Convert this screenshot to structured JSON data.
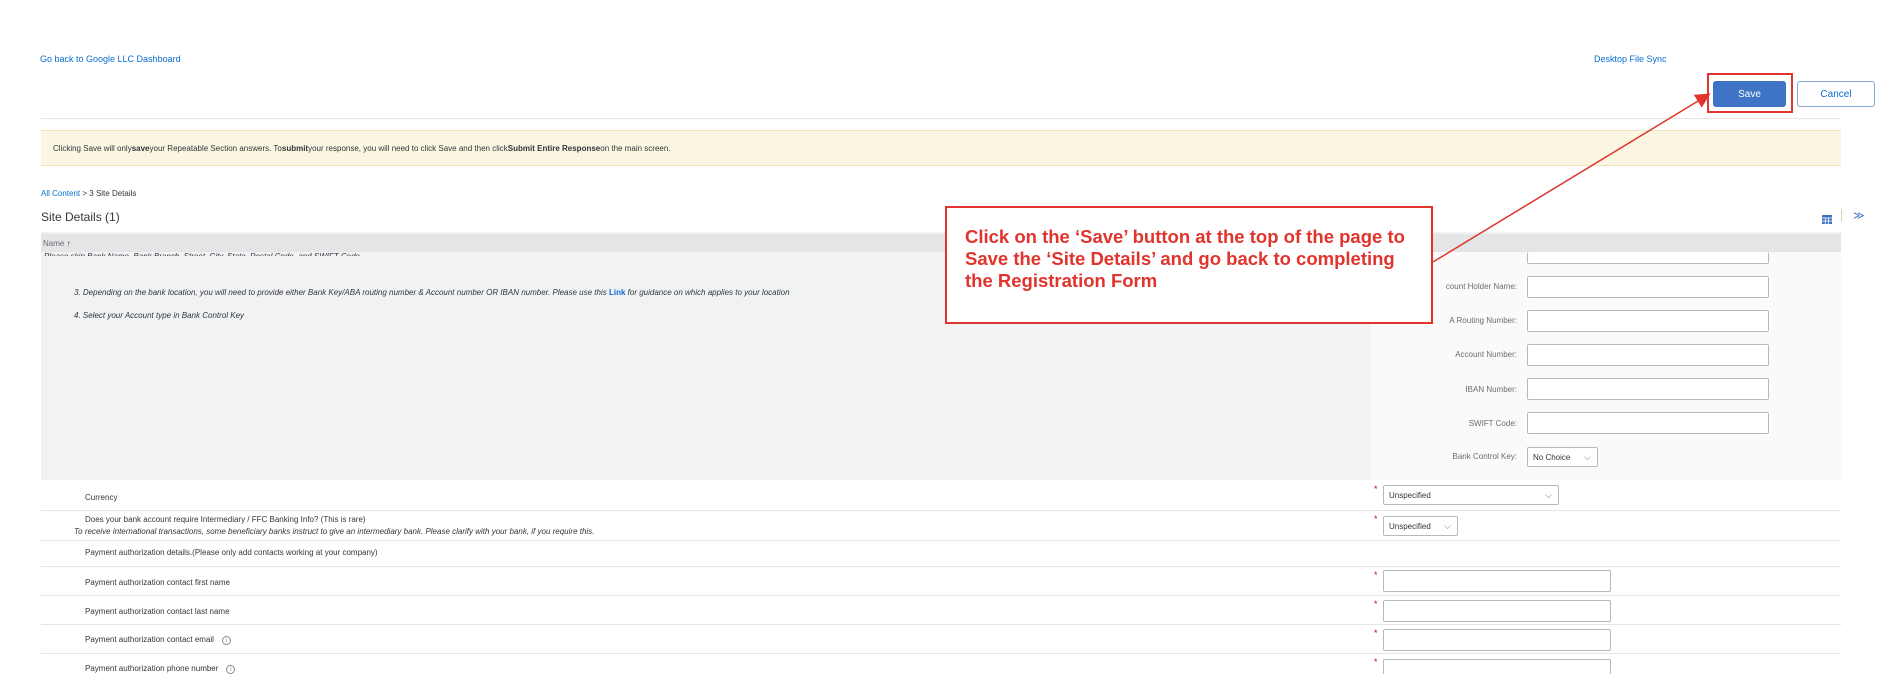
{
  "header": {
    "back_link": "Go back to Google LLC Dashboard",
    "desktop_sync": "Desktop File Sync"
  },
  "toolbar": {
    "save_label": "Save",
    "cancel_label": "Cancel"
  },
  "banner": {
    "p1": "Clicking Save will only ",
    "b1": "save",
    "p2": " your Repeatable Section answers. To ",
    "b2": "submit",
    "p3": " your response, you will need to click Save and then click ",
    "b3": "Submit Entire Response",
    "p4": " on the main screen."
  },
  "breadcrumb": {
    "root": "All Content",
    "sep": " > ",
    "current": "3 Site Details"
  },
  "section": {
    "title": "Site Details (1)",
    "name_col": "Name",
    "name_sort": "↑"
  },
  "instructions": {
    "cut_line": "Please skip Bank Name, Bank Branch, Street, City, State, Postal Code, and SWIFT Code.",
    "line3_pre": "3. Depending on the bank location, you will need to provide either Bank Key/ABA routing number & Account number OR IBAN number. Please use this ",
    "line3_link": "Link",
    "line3_post": " for guidance on which applies to your location",
    "line4": "4. Select your Account type in Bank Control Key"
  },
  "bank_fields": {
    "account_holder": "count Holder Name:",
    "aba_routing": "A Routing Number:",
    "account_number": "Account Number:",
    "iban": "IBAN Number:",
    "swift": "SWIFT Code:",
    "bank_control_key": "Bank Control Key:",
    "bank_control_value": "No Choice"
  },
  "form_rows": {
    "currency_label": "Currency",
    "currency_value": "Unspecified",
    "intermediary_label": "Does your bank account require Intermediary / FFC Banking Info? (This is rare)",
    "intermediary_note": "To receive international transactions, some beneficiary banks instruct to give an intermediary bank. Please clarify with your bank, if you require this.",
    "intermediary_value": "Unspecified",
    "payment_auth_header": "Payment authorization details.(Please only add contacts working at your company)",
    "first_name": "Payment authorization contact first name",
    "last_name": "Payment authorization contact last name",
    "email": "Payment authorization contact email",
    "phone": "Payment authorization phone number",
    "required_mark": "*"
  },
  "callout": {
    "text": "Click on the ‘Save’ button at the top of the page to Save the ‘Site Details’ and go back to completing the Registration  Form"
  },
  "colors": {
    "accent": "#0a6ed1",
    "save_bg": "#3e73c6",
    "callout_red": "#e0342c",
    "banner_bg": "#fbf6e2"
  }
}
